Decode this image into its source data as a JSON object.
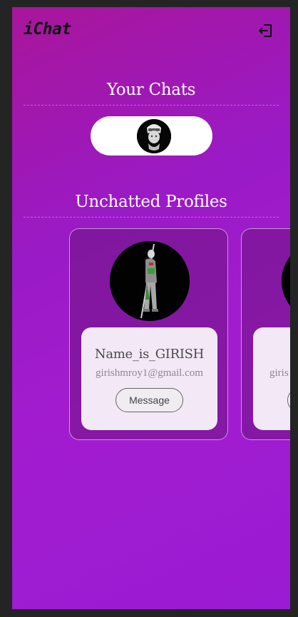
{
  "header": {
    "brand": "iChat",
    "logout_icon": "logout-icon"
  },
  "chats": {
    "title": "Your Chats",
    "items": [
      {
        "avatar": "avatar-image"
      }
    ]
  },
  "unchatted": {
    "title": "Unchatted Profiles",
    "profiles": [
      {
        "name": "Name_is_GIRISH",
        "email": "girishmroy1@gmail.com",
        "button_label": "Message"
      },
      {
        "name": "",
        "email": "giris",
        "button_label": ""
      }
    ]
  },
  "colors": {
    "gradient_start": "#a8169a",
    "gradient_end": "#9a1bd3",
    "page_background": "#242424"
  }
}
